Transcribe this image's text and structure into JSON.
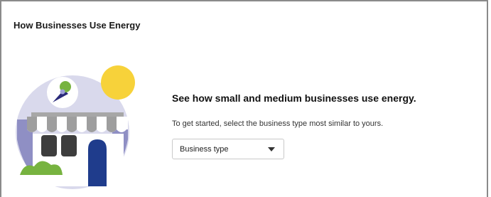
{
  "card": {
    "title": "How Businesses Use Energy"
  },
  "intro": {
    "headline": "See how small and medium businesses use energy.",
    "instructions": "To get started, select the business type most similar to yours."
  },
  "business_type_select": {
    "selected_label": "Business type",
    "icon": "chevron-down-icon"
  },
  "illustration": {
    "subject": "storefront-illustration",
    "colors": {
      "circle": "#d9d9ec",
      "sun": "#f7d23a",
      "awning_gray": "#9e9e9e",
      "wall": "#ffffff",
      "door_blue": "#1f3c8c",
      "window_dark": "#3d3d3d",
      "bush_green": "#77b340",
      "sign": "#2a2a7a",
      "side_purple": "#8f8fc4"
    }
  }
}
